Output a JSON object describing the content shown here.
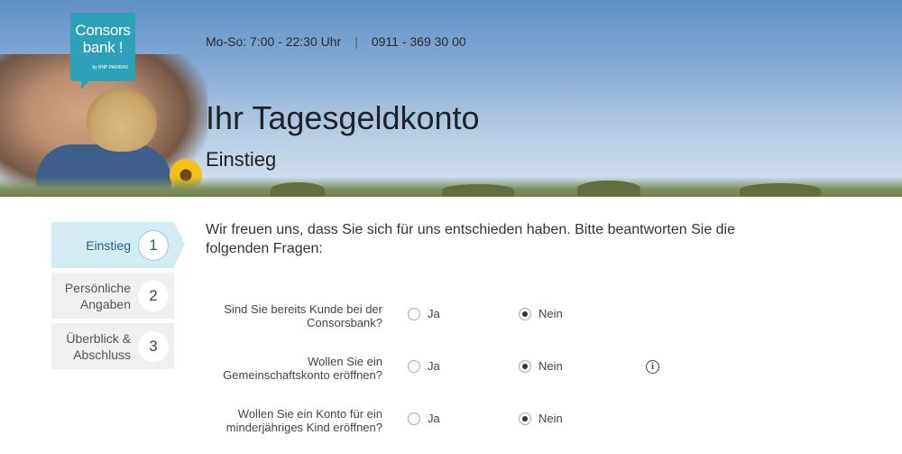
{
  "header": {
    "logo": {
      "line1": "Consors",
      "line2": "bank !",
      "tagline": "by BNP PARIBAS"
    },
    "hours": "Mo-So: 7:00 - 22:30 Uhr",
    "separator": "|",
    "phone": "0911 - 369 30 00",
    "title": "Ihr Tagesgeldkonto",
    "subtitle": "Einstieg"
  },
  "steps": [
    {
      "label": "Einstieg",
      "number": "1",
      "active": true
    },
    {
      "label": "Persönliche Angaben",
      "number": "2",
      "active": false
    },
    {
      "label": "Überblick & Abschluss",
      "number": "3",
      "active": false
    }
  ],
  "intro": "Wir freuen uns, dass Sie sich für uns entschieden haben. Bitte beantworten Sie die folgenden Fragen:",
  "questions": [
    {
      "label": "Sind Sie bereits Kunde bei der Consorsbank?",
      "yes": "Ja",
      "no": "Nein",
      "selected": "Nein",
      "info": false
    },
    {
      "label": "Wollen Sie ein Gemeinschaftskonto eröffnen?",
      "yes": "Ja",
      "no": "Nein",
      "selected": "Nein",
      "info": true
    },
    {
      "label": "Wollen Sie ein Konto für ein minderjähriges Kind eröffnen?",
      "yes": "Ja",
      "no": "Nein",
      "selected": "Nein",
      "info": false
    }
  ],
  "icons": {
    "info": "info-icon"
  },
  "colors": {
    "brand": "#2ea1b8",
    "active_step": "#d3ecf4",
    "step_bg": "#f0f0f0"
  }
}
